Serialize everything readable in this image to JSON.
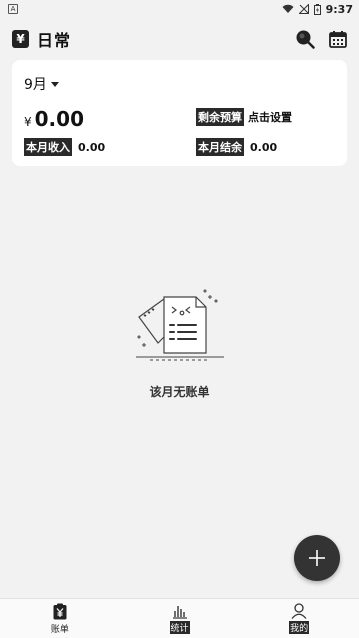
{
  "status_bar": {
    "left_indicator": "A",
    "time": "9:37"
  },
  "header": {
    "logo_glyph": "¥",
    "title": "日常",
    "search_icon": "search-icon",
    "calendar_icon": "calendar-icon"
  },
  "summary": {
    "month": "9月",
    "currency": "¥",
    "amount": "0.00",
    "budget_label": "剩余预算",
    "budget_action": "点击设置",
    "income_label": "本月收入",
    "income_value": "0.00",
    "balance_label": "本月结余",
    "balance_value": "0.00"
  },
  "empty_state": {
    "text": "该月无账单"
  },
  "fab": {
    "icon": "plus-icon"
  },
  "tabs": [
    {
      "label": "账单",
      "icon": "bill-icon"
    },
    {
      "label": "统计",
      "icon": "chart-icon"
    },
    {
      "label": "我的",
      "icon": "user-icon"
    }
  ]
}
